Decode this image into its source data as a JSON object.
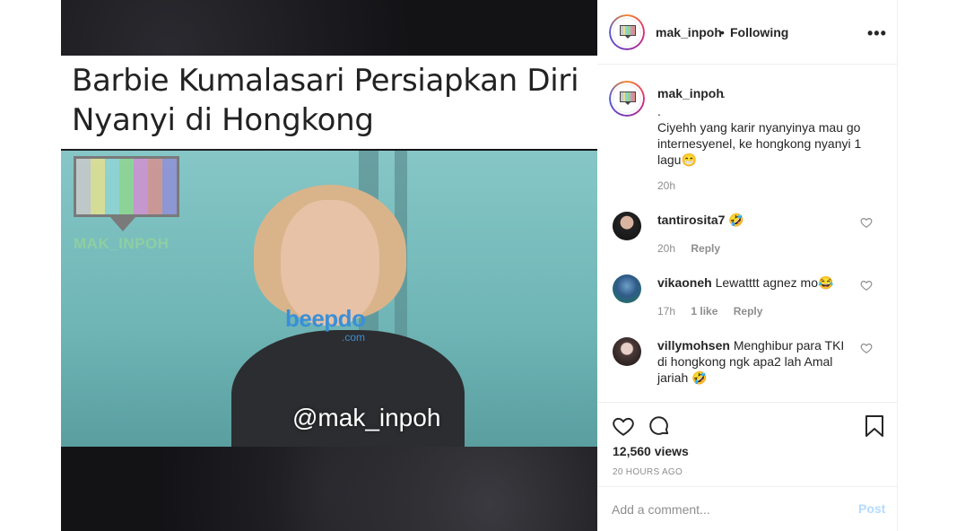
{
  "media": {
    "headline": "Barbie Kumalasari Persiapkan Diri Nyanyi di Hongkong",
    "logo_label": "MAK_INPOH",
    "watermark_beepdo": "beepdo",
    "watermark_beepdo_com": ".com",
    "watermark_handle": "@mak_inpoh",
    "logo_colors": [
      "#c9c9c9",
      "#e4e08f",
      "#8fd3d3",
      "#8fd58f",
      "#d08fd0",
      "#d78f8f",
      "#8f8fd6"
    ]
  },
  "header": {
    "username": "mak_inpoh",
    "separator": "•",
    "follow_state": "Following",
    "more_icon": "more-horizontal-icon"
  },
  "caption": {
    "username": "mak_inpoh",
    "username_suffix": ".",
    "text": ".\nCiyehh yang karir nyanyinya mau go internesyenel, ke hongkong nyanyi 1 lagu😁",
    "time": "20h"
  },
  "comments": [
    {
      "username": "tantirosita7",
      "text": "🤣",
      "time": "20h",
      "likes": "",
      "reply": "Reply"
    },
    {
      "username": "vikaoneh",
      "text": "Lewatttt agnez mo😂",
      "time": "17h",
      "likes": "1 like",
      "reply": "Reply"
    },
    {
      "username": "villymohsen",
      "text": "Menghibur para TKI di hongkong ngk apa2 lah Amal jariah 🤣",
      "time": "",
      "likes": "",
      "reply": ""
    }
  ],
  "actions": {
    "like_icon": "heart-icon",
    "comment_icon": "comment-bubble-icon",
    "save_icon": "bookmark-icon",
    "views": "12,560 views",
    "posted_ago": "20 HOURS AGO"
  },
  "add_comment": {
    "placeholder": "Add a comment...",
    "value": "",
    "post_label": "Post"
  },
  "colors": {
    "link_disabled": "#b3dbff",
    "muted_text": "#8e8e8e",
    "border": "#efefef"
  }
}
